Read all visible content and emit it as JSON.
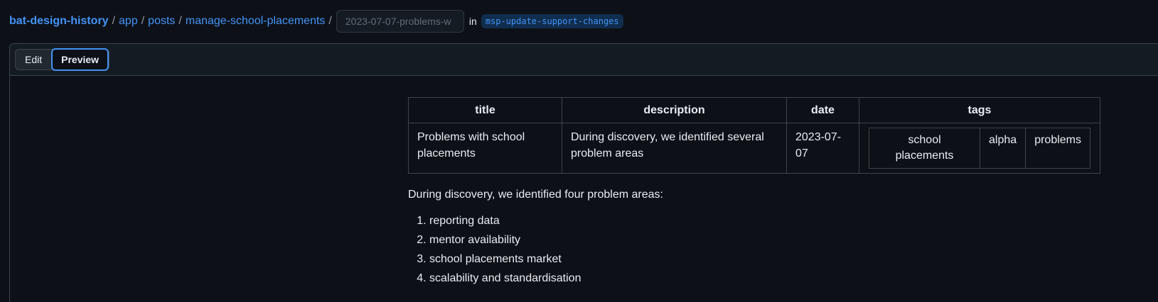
{
  "breadcrumb": {
    "repo": "bat-design-history",
    "path": [
      "app",
      "posts",
      "manage-school-placements"
    ],
    "separator": "/",
    "filename_value": "2023-07-07-problems-w",
    "in_label": "in",
    "branch": "msp-update-support-changes"
  },
  "editor": {
    "tabs": [
      {
        "label": "Edit",
        "active": false
      },
      {
        "label": "Preview",
        "active": true
      }
    ]
  },
  "preview": {
    "table": {
      "headers": [
        "title",
        "description",
        "date",
        "tags"
      ],
      "row": {
        "title": "Problems with school placements",
        "description": "During discovery, we identified several problem areas",
        "date": "2023-07-07",
        "tags": [
          "school placements",
          "alpha",
          "problems"
        ]
      }
    },
    "paragraph": "During discovery, we identified four problem areas:",
    "list": [
      "reporting data",
      "mentor availability",
      "school placements market",
      "scalability and standardisation"
    ]
  },
  "colors": {
    "background": "#0d1117",
    "link": "#4493f8",
    "border": "#3d444d",
    "text": "#e6edf3"
  }
}
